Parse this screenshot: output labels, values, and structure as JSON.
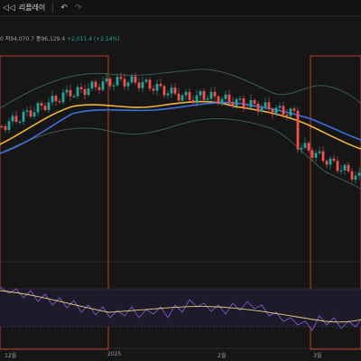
{
  "toolbar": {
    "replay_label": "리플레이",
    "replay_icon": "replay-icon",
    "undo_icon": "undo-icon",
    "redo_icon": "redo-icon"
  },
  "legend": {
    "prefix": "0",
    "low_label": "저",
    "low_value": "94,070.7",
    "close_label": "종",
    "close_value": "96,129.4",
    "change": "+2,011.4 (+2.14%)"
  },
  "colors": {
    "up": "#26a69a",
    "down": "#ef5350",
    "ma_fast": "#f0b43a",
    "ma_slow": "#3d6fe0",
    "band": "#3b5b52",
    "rsi": "#7e57c2",
    "rsi_signal": "#e6d27a",
    "highlight_box": "#c0392b"
  },
  "x_labels": [
    "12월",
    "2025",
    "2월",
    "3월"
  ],
  "chart_data": {
    "type": "line",
    "description": "",
    "x": [],
    "series": []
  }
}
